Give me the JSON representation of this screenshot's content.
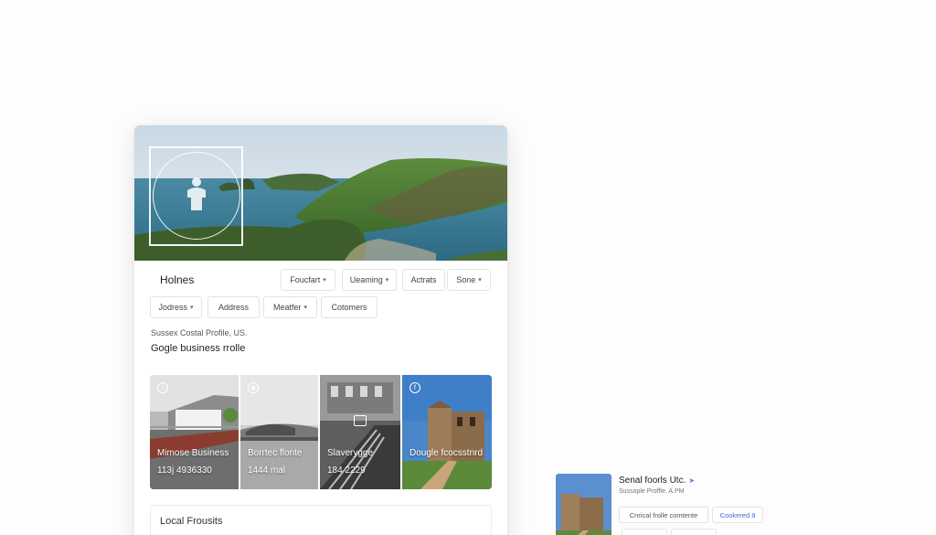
{
  "profile": {
    "title": "Holnes",
    "tabs_row1": [
      {
        "label": "Foucfart",
        "has_dropdown": true
      },
      {
        "label": "Ueaming",
        "has_dropdown": true
      },
      {
        "label": "Actrats",
        "has_dropdown": false
      },
      {
        "label": "Sone",
        "has_dropdown": true
      }
    ],
    "tabs_row2": [
      {
        "label": "Jodress",
        "has_dropdown": true
      },
      {
        "label": "Address",
        "has_dropdown": false
      },
      {
        "label": "Meatfer",
        "has_dropdown": true
      },
      {
        "label": "Cotomers",
        "has_dropdown": false
      }
    ],
    "subtitle": "Sussex Costal Profile, US.",
    "heading": "Gogle business rrolle",
    "gallery": [
      {
        "name": "Mimose Business",
        "number": "113j 4936330",
        "badge_icon": "info-icon"
      },
      {
        "name": "Borrtec flonte",
        "number": "1444 mal",
        "badge_icon": "camera-icon"
      },
      {
        "name": "Slaverygge",
        "number": "184 2229",
        "badge_icon": "",
        "center_icon": "photo-icon"
      },
      {
        "name": "Dougle fcocsstnrd",
        "number": "",
        "badge_icon": "facebook-icon"
      }
    ],
    "local_section_title": "Local Frousits"
  },
  "mini_card": {
    "title": "Senal foorls Utc.",
    "title_icon": "arrow-icon",
    "subtitle": "Sussaple Proffle. A.PM",
    "chips": [
      {
        "label": "Cnrical frolle comtente",
        "color": "#555555"
      },
      {
        "label": "Cookered 8",
        "color": "#3b6fd8"
      }
    ]
  },
  "colors": {
    "sky": "#d8e4ea",
    "sea": "#3f7f99",
    "grass": "#5a8a3a",
    "accent_blue": "#3b6fd8"
  }
}
